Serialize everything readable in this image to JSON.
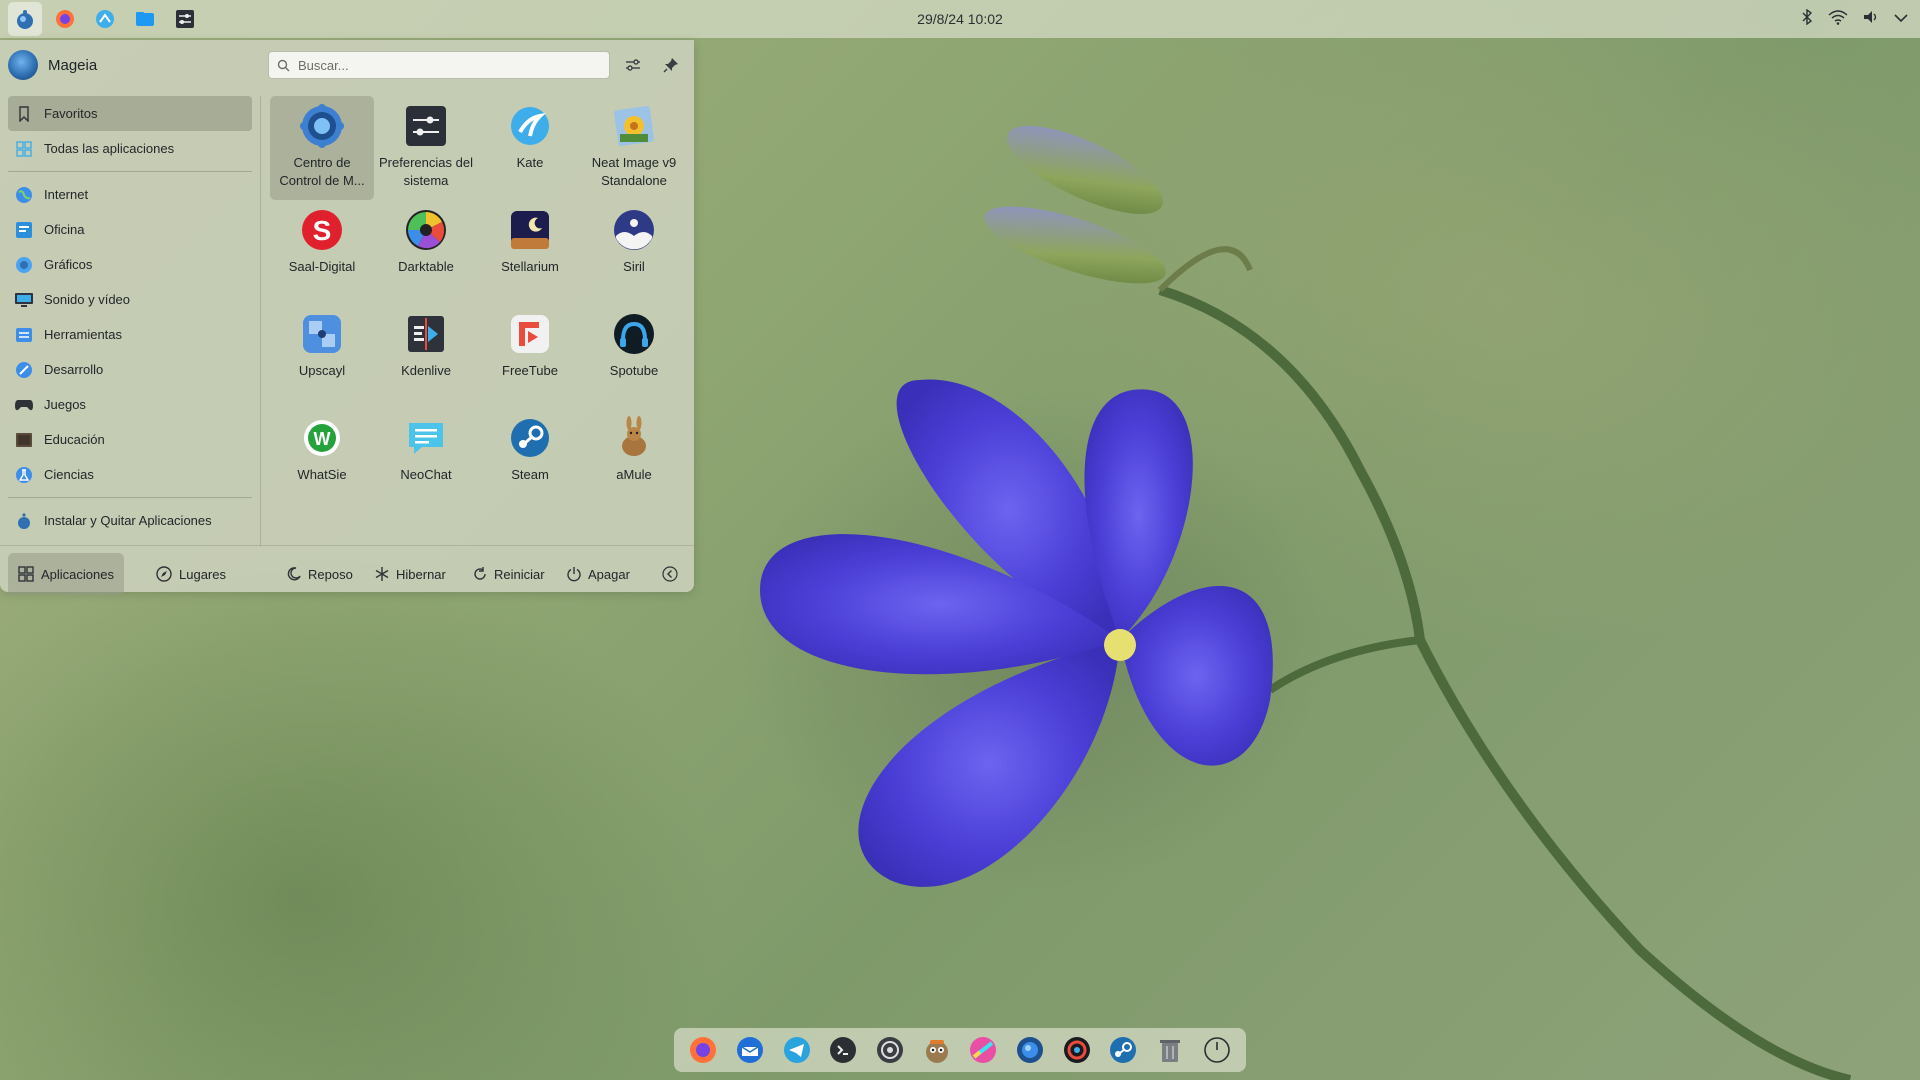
{
  "top_panel": {
    "clock": "29/8/24 10:02",
    "launchers": [
      {
        "name": "app-launcher-icon"
      },
      {
        "name": "firefox-icon"
      },
      {
        "name": "kde-connect-icon"
      },
      {
        "name": "file-manager-icon"
      },
      {
        "name": "system-settings-icon"
      }
    ],
    "tray": [
      "bluetooth-icon",
      "wifi-icon",
      "volume-icon",
      "expand-tray-icon"
    ]
  },
  "launcher": {
    "user_name": "Mageia",
    "search": {
      "placeholder": "Buscar..."
    },
    "categories": [
      {
        "label": "Favoritos",
        "icon": "bookmark-icon",
        "selected": true
      },
      {
        "label": "Todas las aplicaciones",
        "icon": "grid-icon"
      },
      {
        "label": "Internet",
        "icon": "globe-icon"
      },
      {
        "label": "Oficina",
        "icon": "office-icon"
      },
      {
        "label": "Gráficos",
        "icon": "graphics-icon"
      },
      {
        "label": "Sonido y vídeo",
        "icon": "multimedia-icon"
      },
      {
        "label": "Herramientas",
        "icon": "tools-icon"
      },
      {
        "label": "Desarrollo",
        "icon": "development-icon"
      },
      {
        "label": "Juegos",
        "icon": "gamepad-icon"
      },
      {
        "label": "Educación",
        "icon": "education-icon"
      },
      {
        "label": "Ciencias",
        "icon": "science-icon"
      }
    ],
    "install_label": "Instalar y Quitar Aplicaciones",
    "apps": [
      {
        "label": "Centro de Control de M...",
        "icon": "mageia-control-center-icon",
        "selected": true
      },
      {
        "label": "Preferencias del sistema",
        "icon": "system-preferences-icon"
      },
      {
        "label": "Kate",
        "icon": "kate-icon"
      },
      {
        "label": "Neat Image v9 Standalone",
        "icon": "neat-image-icon"
      },
      {
        "label": "Saal-Digital",
        "icon": "saal-digital-icon"
      },
      {
        "label": "Darktable",
        "icon": "darktable-icon"
      },
      {
        "label": "Stellarium",
        "icon": "stellarium-icon"
      },
      {
        "label": "Siril",
        "icon": "siril-icon"
      },
      {
        "label": "Upscayl",
        "icon": "upscayl-icon"
      },
      {
        "label": "Kdenlive",
        "icon": "kdenlive-icon"
      },
      {
        "label": "FreeTube",
        "icon": "freetube-icon"
      },
      {
        "label": "Spotube",
        "icon": "spotube-icon"
      },
      {
        "label": "WhatSie",
        "icon": "whatsie-icon"
      },
      {
        "label": "NeoChat",
        "icon": "neochat-icon"
      },
      {
        "label": "Steam",
        "icon": "steam-icon"
      },
      {
        "label": "aMule",
        "icon": "amule-icon"
      }
    ],
    "footer": {
      "tab_apps": "Aplicaciones",
      "tab_places": "Lugares",
      "sleep": "Reposo",
      "hibernate": "Hibernar",
      "restart": "Reiniciar",
      "shutdown": "Apagar"
    }
  },
  "dock": {
    "items": [
      "firefox-icon",
      "thunderbird-icon",
      "telegram-icon",
      "terminal-icon",
      "aperture-icon",
      "gimp-icon",
      "krita-icon",
      "mageia-icon",
      "obs-icon",
      "steam-icon",
      "trash-icon",
      "power-icon"
    ]
  },
  "colors": {
    "accent": "#3daee9",
    "panel": "#d7dcc8",
    "flower": "#4b3fd8"
  }
}
